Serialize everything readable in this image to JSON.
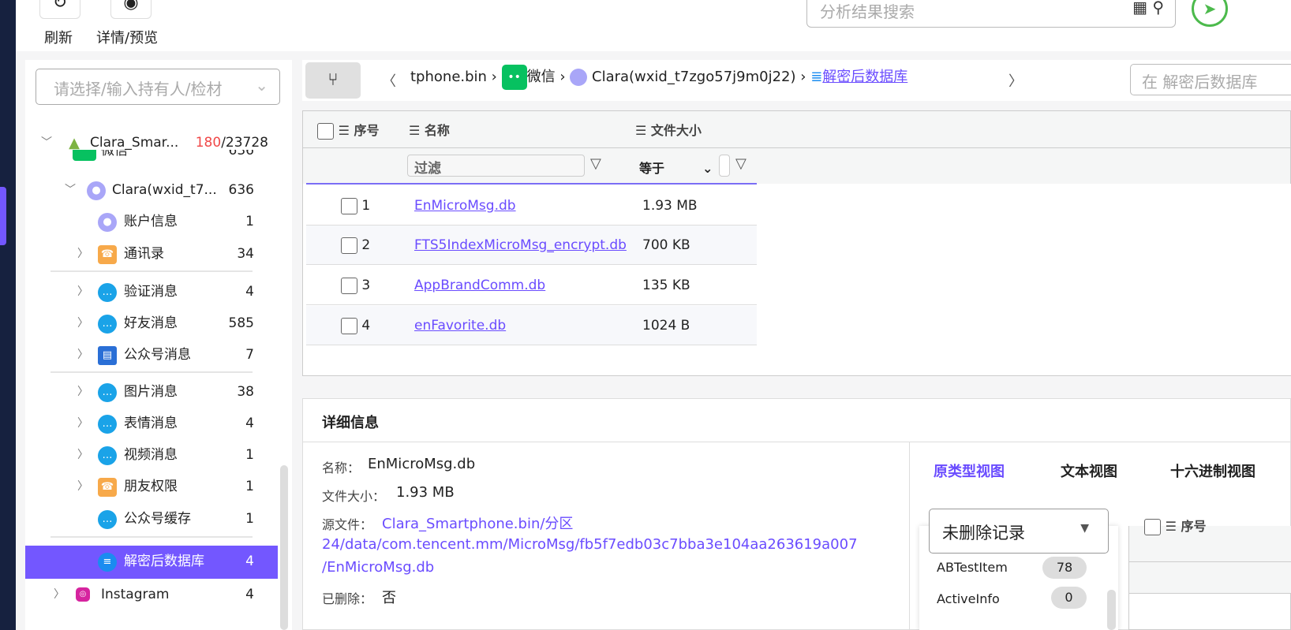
{
  "toolbar": {
    "refresh": "刷新",
    "detail_preview": "详情/预览",
    "search_placeholder": "分析结果搜索"
  },
  "left": {
    "select_placeholder": "请选择/输入持有人/检材",
    "device": {
      "name": "Clara_Smar...",
      "flagged": "180",
      "total": "/23728"
    },
    "wechat": {
      "label": "微信",
      "count": "636"
    },
    "account": {
      "label": "Clara(wxid_t7...",
      "count": "636"
    },
    "items": [
      {
        "label": "账户信息",
        "count": "1"
      },
      {
        "label": "通讯录",
        "count": "34"
      },
      {
        "label": "验证消息",
        "count": "4"
      },
      {
        "label": "好友消息",
        "count": "585"
      },
      {
        "label": "公众号消息",
        "count": "7"
      },
      {
        "label": "图片消息",
        "count": "38"
      },
      {
        "label": "表情消息",
        "count": "4"
      },
      {
        "label": "视频消息",
        "count": "1"
      },
      {
        "label": "朋友权限",
        "count": "1"
      },
      {
        "label": "公众号缓存",
        "count": "1"
      },
      {
        "label": "解密后数据库",
        "count": "4"
      },
      {
        "label": "Instagram",
        "count": "4"
      }
    ]
  },
  "breadcrumb": {
    "items": [
      "tphone.bin",
      "微信",
      "Clara(wxid_t7zgo57j9m0j22)",
      "解密后数据库"
    ],
    "search_placeholder": "在 解密后数据库"
  },
  "table": {
    "headers": [
      "序号",
      "名称",
      "文件大小"
    ],
    "filter_placeholder": "过滤",
    "size_op": "等于",
    "rows": [
      {
        "n": "1",
        "name": "EnMicroMsg.db",
        "size": "1.93 MB"
      },
      {
        "n": "2",
        "name": "FTS5IndexMicroMsg_encrypt.db",
        "size": "700 KB"
      },
      {
        "n": "3",
        "name": "AppBrandComm.db",
        "size": "135 KB"
      },
      {
        "n": "4",
        "name": "enFavorite.db",
        "size": "1024 B"
      }
    ]
  },
  "detail": {
    "title": "详细信息",
    "name_k": "名称：",
    "name_v": "EnMicroMsg.db",
    "size_k": "文件大小：",
    "size_v": "1.93 MB",
    "src_k": "源文件：",
    "src_v1": "Clara_Smartphone.bin/分区",
    "src_v2": "24/data/com.tencent.mm/MicroMsg/fb5f7edb03c7bba3e104aa263619a007",
    "src_v3": "/EnMicroMsg.db",
    "del_k": "已删除：",
    "del_v": "否",
    "tabs": [
      "原类型视图",
      "文本视图",
      "十六进制视图"
    ],
    "dropdown": "未删除记录",
    "tables": [
      {
        "name": "ABTestItem",
        "count": "78"
      },
      {
        "name": "ActiveInfo",
        "count": "0"
      }
    ],
    "col": "序号"
  }
}
